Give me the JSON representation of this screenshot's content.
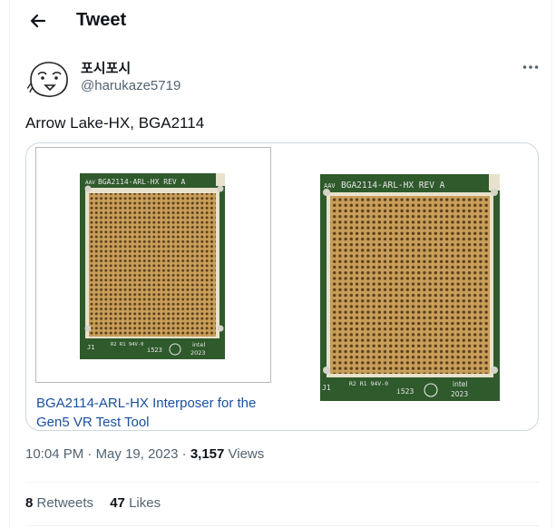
{
  "header": {
    "title": "Tweet",
    "back_icon": "arrow-left-icon"
  },
  "author": {
    "display_name": "포시포시",
    "handle": "@harukaze5719",
    "avatar_icon": "doodle-face-avatar"
  },
  "more_icon": "more-horizontal-icon",
  "tweet": {
    "text": "Arrow Lake-HX, BGA2114"
  },
  "card": {
    "title": "BGA2114-ARL-HX Interposer for the Gen5 VR Test Tool",
    "board_label": "BGA2114-ARL-HX REV A",
    "board_bottom_left": "J1",
    "board_bottom_mid": "R2 R1 94V-0",
    "board_bottom_code": "i523",
    "board_brand": "intel",
    "board_year": "2023",
    "board_side_mark": "AAV"
  },
  "meta": {
    "time": "10:04 PM",
    "sep1": " · ",
    "date": "May 19, 2023",
    "sep2": " · ",
    "views_count": "3,157",
    "views_label": " Views"
  },
  "stats": {
    "retweets_count": "8",
    "retweets_label": " Retweets",
    "likes_count": "47",
    "likes_label": " Likes"
  },
  "colors": {
    "link": "#1a4f9e",
    "secondary": "#536471",
    "pcb_green": "#2f5a2c",
    "gold": "#b9904c"
  }
}
